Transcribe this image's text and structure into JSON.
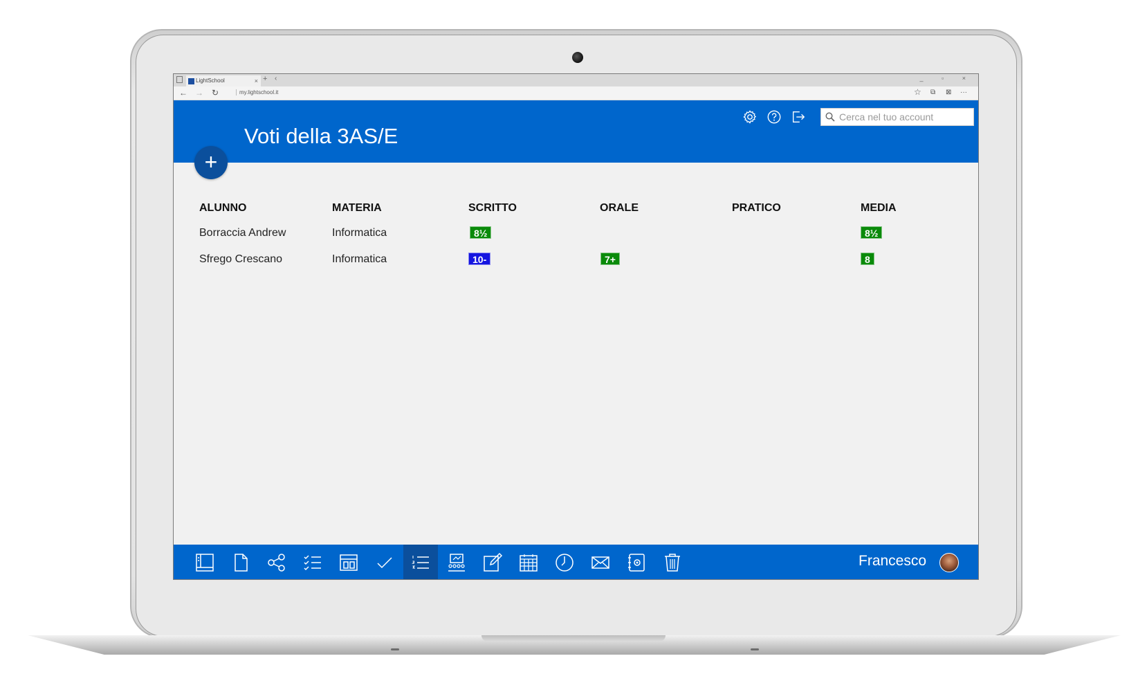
{
  "browser": {
    "tab_title": "LightSchool",
    "url": "my.lightschool.it",
    "new_tab": "+",
    "tab_close": "×",
    "tabs_chevron": "‹",
    "back": "←",
    "forward": "→",
    "refresh": "↻",
    "favorite": "☆",
    "share": "⧉",
    "notes": "⊠",
    "more": "···",
    "window_controls": "_ ▫ ×"
  },
  "header": {
    "title": "Voti della 3AS/E",
    "search_placeholder": "Cerca nel tuo account",
    "icons": [
      "gear-icon",
      "help-icon",
      "logout-icon"
    ],
    "color": "#0066cc"
  },
  "fab": {
    "label": "+"
  },
  "grades_table": {
    "columns": [
      "ALUNNO",
      "MATERIA",
      "SCRITTO",
      "ORALE",
      "PRATICO",
      "MEDIA"
    ],
    "rows": [
      {
        "alunno": "Borraccia Andrew",
        "materia": "Informatica",
        "scritto": "8½",
        "orale": "",
        "pratico": "",
        "media": "8½"
      },
      {
        "alunno": "Sfrego Crescano",
        "materia": "Informatica",
        "scritto": "10-",
        "orale": "7+",
        "pratico": "",
        "media": "8"
      }
    ],
    "badge_colors": {
      "green": "#0a8a0a",
      "blue": "#1515e0"
    }
  },
  "taskbar": {
    "items": [
      "desktop-icon",
      "file-icon",
      "share-icon",
      "checklist-icon",
      "diary-icon",
      "check-icon",
      "list-icon",
      "classroom-icon",
      "edit-icon",
      "calendar-icon",
      "clock-icon",
      "mail-icon",
      "contacts-icon",
      "trash-icon"
    ],
    "active": "list-icon",
    "user": "Francesco"
  }
}
